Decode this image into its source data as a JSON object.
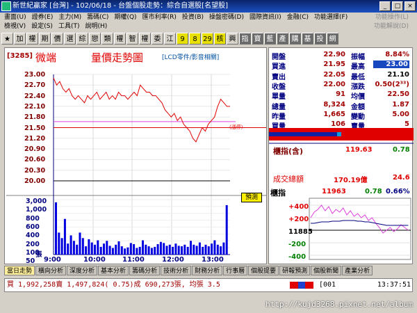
{
  "window": {
    "title": "新世紀贏家 [台灣] - 102/06/18 - 台盤個股走勢：綜合自選股[名望股]",
    "buttons": [
      "_",
      "□",
      "×"
    ]
  },
  "menu": {
    "row1": [
      "畫面(U)",
      "證券(E)",
      "主力(M)",
      "籌碼(C)",
      "期權(Q)",
      "匯市利率(R)",
      "投資(B)",
      "操盤密碼(D)",
      "國際資訊(I)",
      "金融(C)",
      "功能選擇(F)"
    ],
    "row1_right": "功能操作(L)",
    "row2": [
      "檢視(V)",
      "設定(S)",
      "工具(T)",
      "說明(H)"
    ],
    "row2_right": "功能解說(D)"
  },
  "toolbar": [
    "★",
    "加",
    "權",
    "期",
    "價",
    "選",
    "綜",
    "戀",
    "類",
    "權",
    "智",
    "權",
    "委",
    "江",
    "9",
    "8",
    "29",
    "核",
    "興",
    "指",
    "寶",
    "藍",
    "產",
    "購",
    "基",
    "投",
    "網"
  ],
  "stock": {
    "code": "[3285]",
    "name": "微端",
    "chart_title": "量價走勢圖",
    "industry": "[LCD零件/影音相關]"
  },
  "axis": {
    "price_ticks": [
      "23.00",
      "22.70",
      "22.40",
      "22.10",
      "21.80",
      "21.50",
      "21.20",
      "20.90",
      "20.60",
      "20.30",
      "20.00"
    ],
    "volume_ticks": [
      "3,000",
      "1,000",
      "800",
      "600",
      "400",
      "200",
      "100",
      "50",
      "15"
    ],
    "volume_unit": "張",
    "time_ticks": [
      "9:00",
      "10:00",
      "11:00",
      "12:00",
      "13:00"
    ]
  },
  "annotations": {
    "limit_label": "(漲停)",
    "forecast": "預測"
  },
  "quote": {
    "rows": [
      {
        "l1": "開盤",
        "v1": "22.90",
        "l2": "振幅",
        "v2": "8.84%"
      },
      {
        "l1": "買進",
        "v1": "21.95",
        "l2": "最高",
        "v2": "23.00"
      },
      {
        "l1": "賣出",
        "v1": "22.05",
        "l2": "最低",
        "v2": "21.10"
      },
      {
        "l1": "收盤",
        "v1": "22.00",
        "l2": "漲跌",
        "v2": "0.50(2³³)"
      },
      {
        "l1": "單量",
        "v1": "91",
        "l2": "均價",
        "v2": "22.50"
      },
      {
        "l1": "總量",
        "v1": "8,324",
        "l2": "金額",
        "v2": "1.87"
      },
      {
        "l1": "昨量",
        "v1": "1,665",
        "l2": "變動",
        "v2": "5.00"
      },
      {
        "l1": "買量",
        "v1": "106",
        "l2": "賣量",
        "v2": "5"
      }
    ]
  },
  "index": {
    "label": "櫃指(含)",
    "value": "119.63",
    "change": "0.78",
    "turnover_label": "成交總額",
    "turnover_value": "170.19億",
    "turnover_change": "24.6",
    "mini_label": "櫃指",
    "mini_value": "11963",
    "mini_change": "0.78",
    "mini_pct": "0.66%",
    "mini_ticks": [
      "+400",
      "+200",
      "11885",
      "-200",
      "-400"
    ]
  },
  "tabs": [
    "當日走勢",
    "橫向分析",
    "深度分析",
    "基本分析",
    "籌碼分析",
    "技術分析",
    "財務分析",
    "行事曆",
    "個股提要",
    "研報預測",
    "個股新聞",
    "產業分析"
  ],
  "status": {
    "text": "買 1,992,258賣 1,497,824( 0.75)成 690,273張, 均張 3.5",
    "code": "[001",
    "time": "13:37:51"
  },
  "watermark": "http://kujd3268.pixnet.net/album",
  "colors": {
    "price_line": "#e00000",
    "avg_line": "#e040e0",
    "volume_bar": "#0000e0",
    "ref_line": "#e00000"
  },
  "chart_data": {
    "type": "line",
    "price_range": [
      20.0,
      23.0
    ],
    "reference": 21.5,
    "average": 21.67,
    "price": [
      22.9,
      22.7,
      22.8,
      22.6,
      22.5,
      22.6,
      22.4,
      22.3,
      22.4,
      22.3,
      22.2,
      22.4,
      22.3,
      22.4,
      22.5,
      22.3,
      22.4,
      22.5,
      22.3,
      22.4,
      22.3,
      22.5,
      22.4,
      22.4,
      22.3,
      22.4,
      22.5,
      22.4,
      22.7,
      22.6,
      22.5,
      22.5,
      22.4,
      22.4,
      22.3,
      22.2,
      22.0,
      21.9,
      21.8,
      21.9,
      21.7,
      21.8,
      21.6,
      21.5,
      21.4,
      21.2,
      21.1,
      21.3,
      21.5,
      21.4,
      21.6,
      21.7,
      21.8,
      22.1,
      22.3,
      22.2,
      22.1,
      22.1
    ],
    "volume": [
      950,
      400,
      300,
      650,
      200,
      350,
      250,
      180,
      400,
      300,
      150,
      280,
      220,
      180,
      260,
      140,
      200,
      250,
      160,
      120,
      180,
      240,
      150,
      110,
      130,
      210,
      190,
      120,
      140,
      260,
      180,
      150,
      120,
      140,
      190,
      230,
      210,
      160,
      180,
      140,
      200,
      160,
      150,
      180,
      140,
      250,
      180,
      160,
      220,
      140,
      180,
      150,
      200,
      260,
      180,
      150,
      220,
      900
    ]
  }
}
